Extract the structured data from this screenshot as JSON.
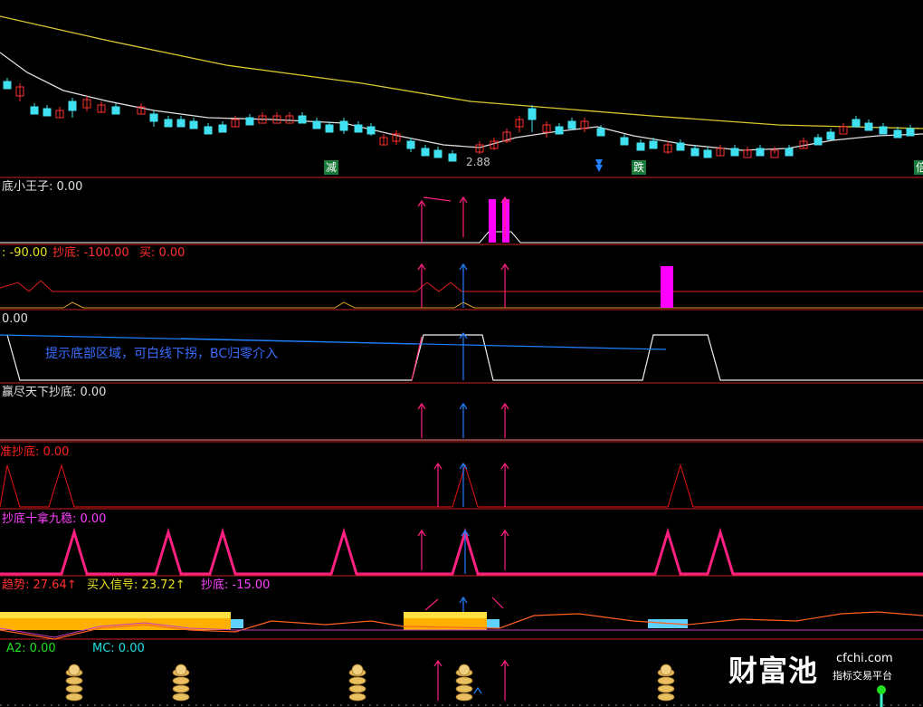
{
  "panels": {
    "p1": {
      "title": "底小王子: 0.00"
    },
    "p2": {
      "a": ": -90.00",
      "b": "抄底: -100.00",
      "c": "买: 0.00"
    },
    "p3": {
      "title": "0.00",
      "note": "提示底部区域，可白线下拐，BC归零介入"
    },
    "p4": {
      "title": "赢尽天下抄底: 0.00"
    },
    "p5": {
      "title": "准抄底: 0.00"
    },
    "p6": {
      "title": "抄底十拿九稳: 0.00"
    },
    "p7": {
      "a": "趋势: 27.64↑",
      "b": "买入信号: 23.72↑",
      "c": "抄底: -15.00"
    },
    "p8": {
      "a": "A2: 0.00",
      "b": "MC: 0.00"
    }
  },
  "main": {
    "low_label": "2.88",
    "markers": [
      "减",
      "跌",
      "倍"
    ]
  },
  "watermark": {
    "logo": "财富池",
    "site": "cfchi.com",
    "slogan": "指标交易平台"
  },
  "colors": {
    "red": "#ff3030",
    "magenta": "#ff00ff",
    "cyan": "#00ffff",
    "yellow_line": "#d8c830",
    "white_line": "#e0e0e0",
    "pink_arrow": "#ff2080",
    "blue_arrow": "#2080ff",
    "divider": "#c82020"
  }
}
